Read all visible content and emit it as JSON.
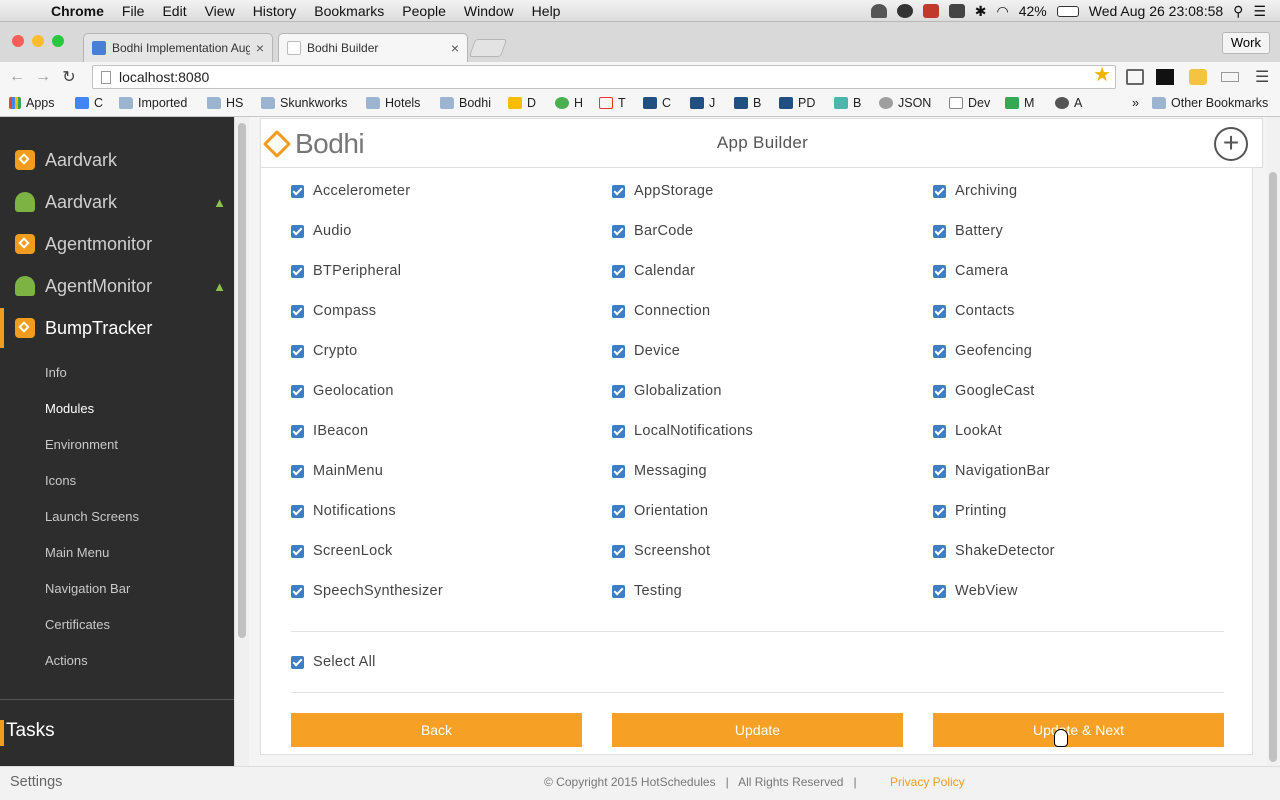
{
  "macos_menu": {
    "app": "Chrome",
    "items": [
      "File",
      "Edit",
      "View",
      "History",
      "Bookmarks",
      "People",
      "Window",
      "Help"
    ],
    "battery": "42%",
    "clock": "Wed Aug 26  23:08:58"
  },
  "browser": {
    "tabs": [
      {
        "label": "Bodhi Implementation Aug"
      },
      {
        "label": "Bodhi Builder"
      }
    ],
    "profile": "Work",
    "url": "localhost:8080",
    "bookmarks": [
      "Apps",
      "C",
      "Imported",
      "HS",
      "Skunkworks",
      "Hotels",
      "Bodhi",
      "D",
      "H",
      "T",
      "C",
      "J",
      "B",
      "PD",
      "B",
      "JSON",
      "Dev",
      "M",
      "A"
    ],
    "more_bookmarks": "»",
    "other_bookmarks": "Other Bookmarks"
  },
  "sidebar": {
    "apps": [
      {
        "name": "Aardvark",
        "platform": "apple"
      },
      {
        "name": "Aardvark",
        "platform": "android"
      },
      {
        "name": "Agentmonitor",
        "platform": "apple"
      },
      {
        "name": "AgentMonitor",
        "platform": "android"
      },
      {
        "name": "BumpTracker",
        "platform": "apple",
        "active": true
      }
    ],
    "sub_items": [
      "Info",
      "Modules",
      "Environment",
      "Icons",
      "Launch Screens",
      "Main Menu",
      "Navigation Bar",
      "Certificates",
      "Actions"
    ],
    "active_sub": "Modules",
    "tasks_label": "Tasks",
    "settings_label": "Settings"
  },
  "header": {
    "brand": "Bodhi",
    "title": "App Builder",
    "add_icon": "+"
  },
  "modules": [
    "Accelerometer",
    "AppStorage",
    "Archiving",
    "Audio",
    "BarCode",
    "Battery",
    "BTPeripheral",
    "Calendar",
    "Camera",
    "Compass",
    "Connection",
    "Contacts",
    "Crypto",
    "Device",
    "Geofencing",
    "Geolocation",
    "Globalization",
    "GoogleCast",
    "IBeacon",
    "LocalNotifications",
    "LookAt",
    "MainMenu",
    "Messaging",
    "NavigationBar",
    "Notifications",
    "Orientation",
    "Printing",
    "ScreenLock",
    "Screenshot",
    "ShakeDetector",
    "SpeechSynthesizer",
    "Testing",
    "WebView"
  ],
  "select_all_label": "Select All",
  "buttons": {
    "back": "Back",
    "update": "Update",
    "update_next": "Update & Next"
  },
  "footer": {
    "copyright": "© Copyright 2015 HotSchedules   |   All Rights Reserved   |",
    "privacy": "Privacy Policy"
  },
  "colors": {
    "accent": "#f6a125",
    "sidebar_bg": "#2d2d2d",
    "checkbox": "#3e7fc4"
  }
}
